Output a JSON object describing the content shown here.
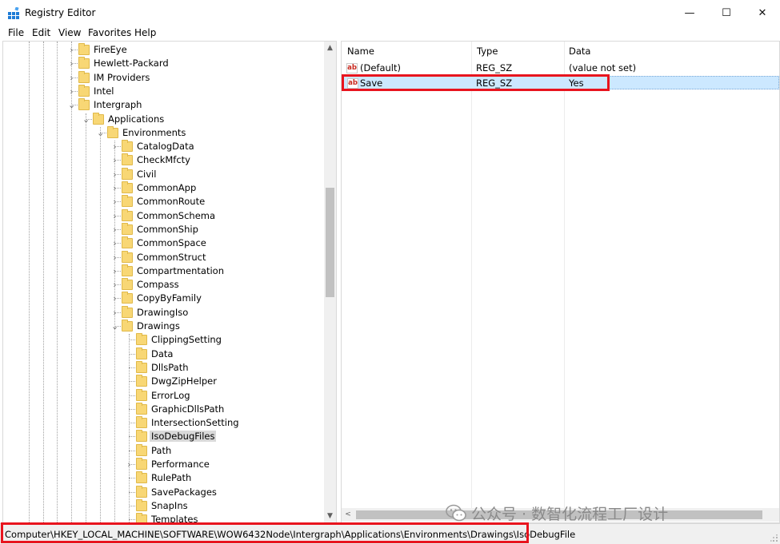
{
  "window": {
    "title": "Registry Editor",
    "minimize_glyph": "—",
    "maximize_glyph": "☐",
    "close_glyph": "✕"
  },
  "menu": [
    "File",
    "Edit",
    "View",
    "Favorites",
    "Help"
  ],
  "tree": {
    "items": [
      {
        "label": "FireEye",
        "expander": "›"
      },
      {
        "label": "Hewlett-Packard",
        "expander": "›"
      },
      {
        "label": "IM Providers",
        "expander": "›"
      },
      {
        "label": "Intel",
        "expander": "›"
      },
      {
        "label": "Intergraph",
        "expander": "⌄"
      },
      {
        "label": "Applications",
        "expander": "⌄"
      },
      {
        "label": "Environments",
        "expander": "⌄"
      },
      {
        "label": "CatalogData",
        "expander": "›"
      },
      {
        "label": "CheckMfcty",
        "expander": "›"
      },
      {
        "label": "Civil",
        "expander": "›"
      },
      {
        "label": "CommonApp",
        "expander": "›"
      },
      {
        "label": "CommonRoute",
        "expander": "›"
      },
      {
        "label": "CommonSchema",
        "expander": "›"
      },
      {
        "label": "CommonShip",
        "expander": "›"
      },
      {
        "label": "CommonSpace",
        "expander": "›"
      },
      {
        "label": "CommonStruct",
        "expander": "›"
      },
      {
        "label": "Compartmentation",
        "expander": "›"
      },
      {
        "label": "Compass",
        "expander": "›"
      },
      {
        "label": "CopyByFamily",
        "expander": "›"
      },
      {
        "label": "DrawingIso",
        "expander": "›"
      },
      {
        "label": "Drawings",
        "expander": "⌄"
      },
      {
        "label": "ClippingSetting",
        "expander": ""
      },
      {
        "label": "Data",
        "expander": ""
      },
      {
        "label": "DllsPath",
        "expander": ""
      },
      {
        "label": "DwgZipHelper",
        "expander": ""
      },
      {
        "label": "ErrorLog",
        "expander": ""
      },
      {
        "label": "GraphicDllsPath",
        "expander": ""
      },
      {
        "label": "IntersectionSetting",
        "expander": ""
      },
      {
        "label": "IsoDebugFiles",
        "expander": ""
      },
      {
        "label": "Path",
        "expander": ""
      },
      {
        "label": "Performance",
        "expander": "›"
      },
      {
        "label": "RulePath",
        "expander": ""
      },
      {
        "label": "SavePackages",
        "expander": ""
      },
      {
        "label": "SnapIns",
        "expander": ""
      },
      {
        "label": "Templates",
        "expander": ""
      }
    ],
    "selected": "IsoDebugFiles"
  },
  "list": {
    "columns": [
      "Name",
      "Type",
      "Data"
    ],
    "icon_text": "ab",
    "rows": [
      {
        "name": "(Default)",
        "type": "REG_SZ",
        "data": "(value not set)"
      },
      {
        "name": "Save",
        "type": "REG_SZ",
        "data": "Yes"
      }
    ]
  },
  "scroll": {
    "up_glyph": "▲",
    "down_glyph": "▼",
    "left_glyph": "<"
  },
  "watermark": {
    "text": "公众号 · 数智化流程工厂设计"
  },
  "status": {
    "path": "Computer\\HKEY_LOCAL_MACHINE\\SOFTWARE\\WOW6432Node\\Intergraph\\Applications\\Environments\\Drawings\\IsoDebugFile"
  },
  "colors": {
    "highlight": "#e8141e",
    "selection": "#cce8ff",
    "folder": "#f8d775"
  }
}
